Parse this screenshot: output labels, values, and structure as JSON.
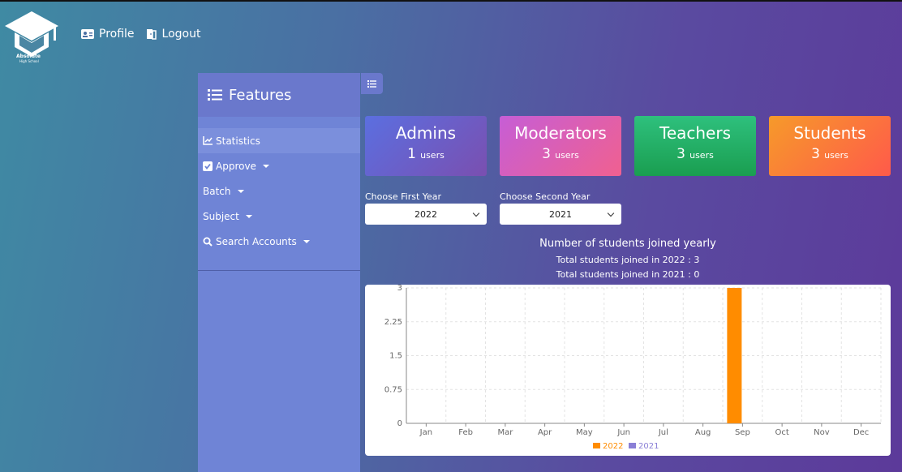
{
  "header": {
    "logo_line1": "Absolute",
    "logo_line2": "High School",
    "nav": [
      {
        "label": "Profile",
        "icon": "id-card-icon"
      },
      {
        "label": "Logout",
        "icon": "door-icon"
      }
    ]
  },
  "sidebar": {
    "title": "Features",
    "items": [
      {
        "label": "Statistics",
        "icon": "chart-line-icon",
        "dropdown": false,
        "active": true
      },
      {
        "label": "Approve",
        "icon": "checkbox-icon",
        "dropdown": true
      },
      {
        "label": "Batch",
        "icon": "",
        "dropdown": true
      },
      {
        "label": "Subject",
        "icon": "",
        "dropdown": true
      },
      {
        "label": "Search Accounts",
        "icon": "search-icon",
        "dropdown": true
      }
    ]
  },
  "stats": [
    {
      "title": "Admins",
      "count": "1",
      "unit": "users"
    },
    {
      "title": "Moderators",
      "count": "3",
      "unit": "users"
    },
    {
      "title": "Teachers",
      "count": "3",
      "unit": "users"
    },
    {
      "title": "Students",
      "count": "3",
      "unit": "users"
    }
  ],
  "filters": {
    "first_year_label": "Choose First Year",
    "first_year_value": "2022",
    "second_year_label": "Choose Second Year",
    "second_year_value": "2021"
  },
  "chart_text": {
    "title": "Number of students joined yearly",
    "line1": "Total students joined in 2022 : 3",
    "line2": "Total students joined in 2021 : 0"
  },
  "colors": {
    "series_2022": "#ff8c00",
    "series_2021": "#8a7fd6"
  },
  "chart_data": {
    "type": "bar",
    "categories": [
      "Jan",
      "Feb",
      "Mar",
      "Apr",
      "May",
      "Jun",
      "Jul",
      "Aug",
      "Sep",
      "Oct",
      "Nov",
      "Dec"
    ],
    "series": [
      {
        "name": "2022",
        "values": [
          0,
          0,
          0,
          0,
          0,
          0,
          0,
          0,
          3,
          0,
          0,
          0
        ]
      },
      {
        "name": "2021",
        "values": [
          0,
          0,
          0,
          0,
          0,
          0,
          0,
          0,
          0,
          0,
          0,
          0
        ]
      }
    ],
    "yticks": [
      "0",
      "0.75",
      "1.5",
      "2.25",
      "3"
    ],
    "ylim": [
      0,
      3
    ],
    "grid": true,
    "legend": "bottom"
  }
}
